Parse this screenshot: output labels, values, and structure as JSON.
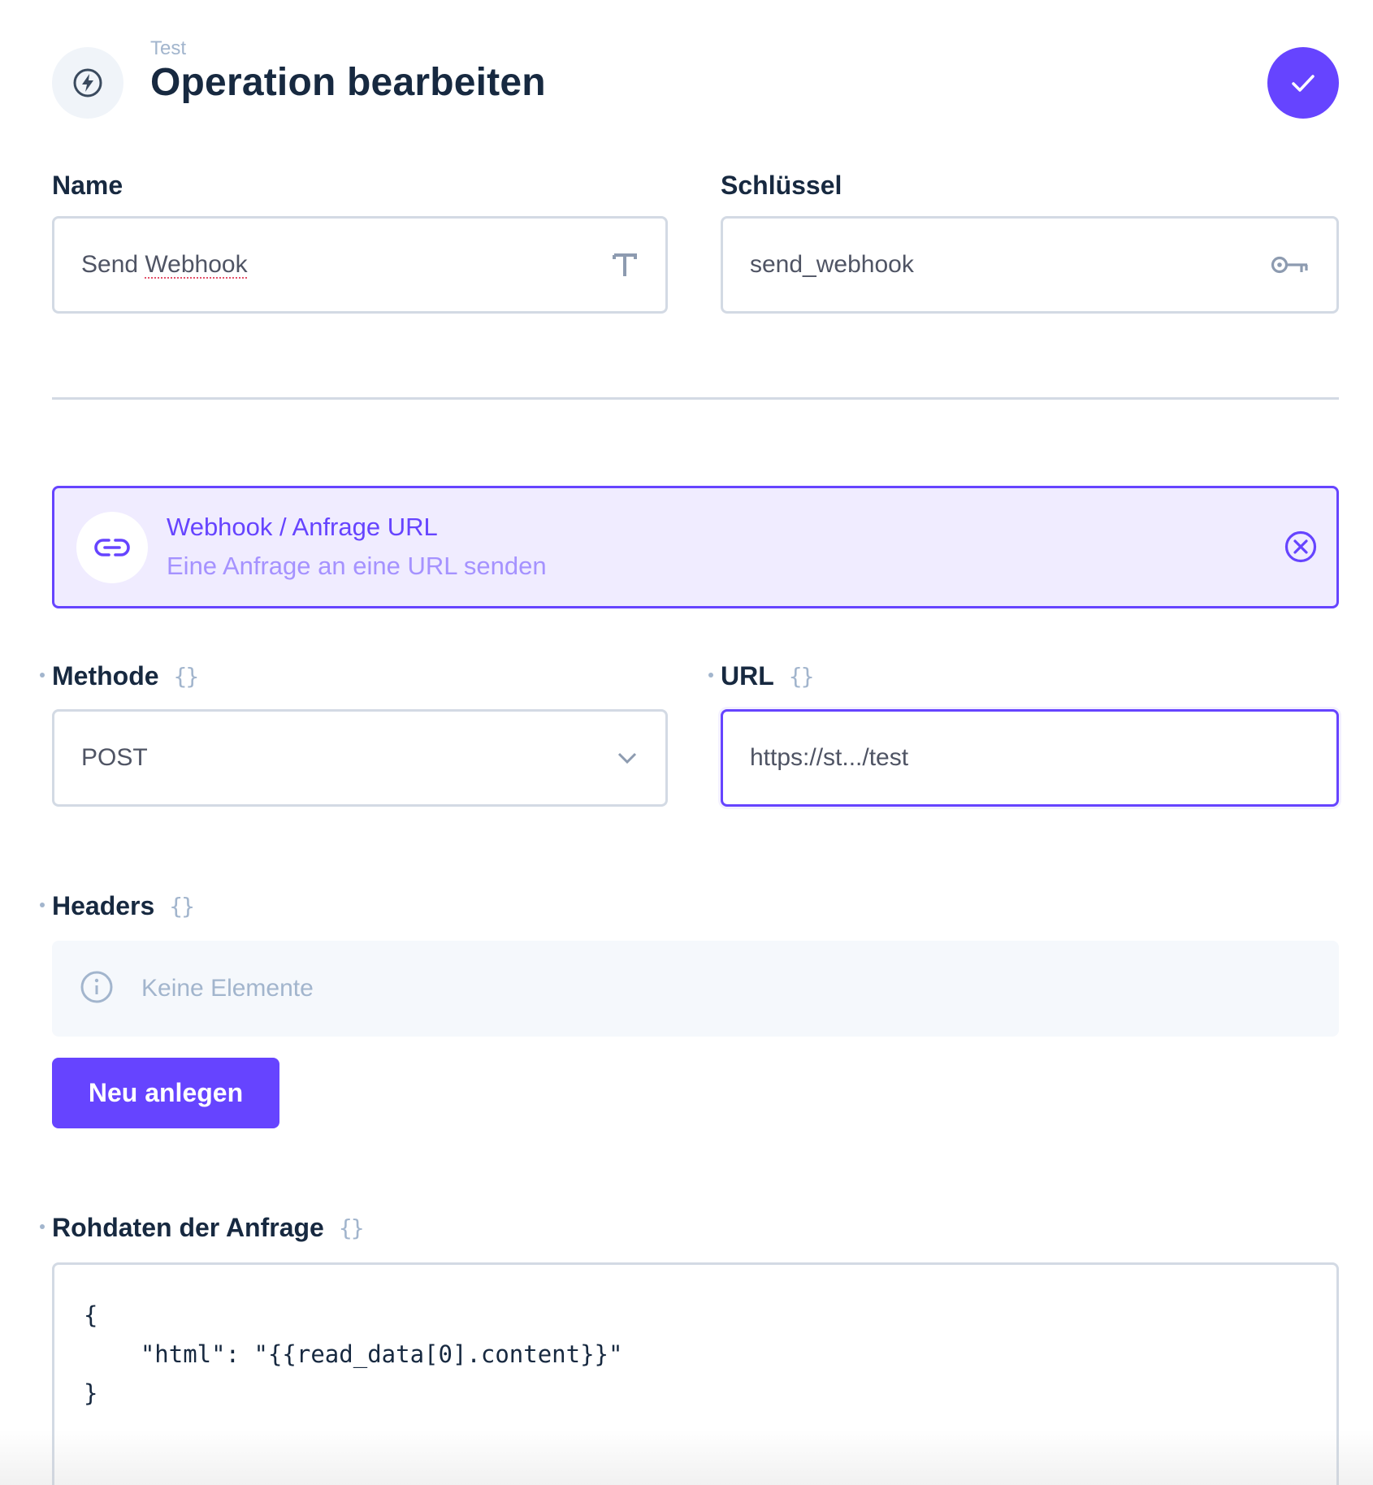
{
  "header": {
    "subtitle": "Test",
    "title": "Operation bearbeiten",
    "icon": "bolt-icon",
    "save_icon": "check-icon"
  },
  "fields": {
    "name": {
      "label": "Name",
      "value": "Send Webhook",
      "value_plain": "Send ",
      "value_marked": "Webhook",
      "icon": "text-type-icon"
    },
    "key": {
      "label": "Schlüssel",
      "value": "send_webhook",
      "icon": "key-icon"
    }
  },
  "operation": {
    "title": "Webhook / Anfrage URL",
    "description": "Eine Anfrage an eine URL senden",
    "icon": "link-icon",
    "close_icon": "close-circle-icon"
  },
  "method": {
    "label": "Methode",
    "value": "POST",
    "variable_icon": "{}"
  },
  "url": {
    "label": "URL",
    "value": "https://st.../test",
    "variable_icon": "{}"
  },
  "headers": {
    "label": "Headers",
    "variable_icon": "{}",
    "empty_text": "Keine Elemente",
    "add_button": "Neu anlegen"
  },
  "body": {
    "label": "Rohdaten der Anfrage",
    "variable_icon": "{}",
    "lines": [
      "{",
      "    \"html\": \"{{read_data[0].content}}\"",
      "}"
    ]
  },
  "colors": {
    "accent": "#6644ff",
    "accent_light": "#f0ecff",
    "muted": "#a2b5cd",
    "text": "#172940",
    "border": "#d3dae4"
  }
}
